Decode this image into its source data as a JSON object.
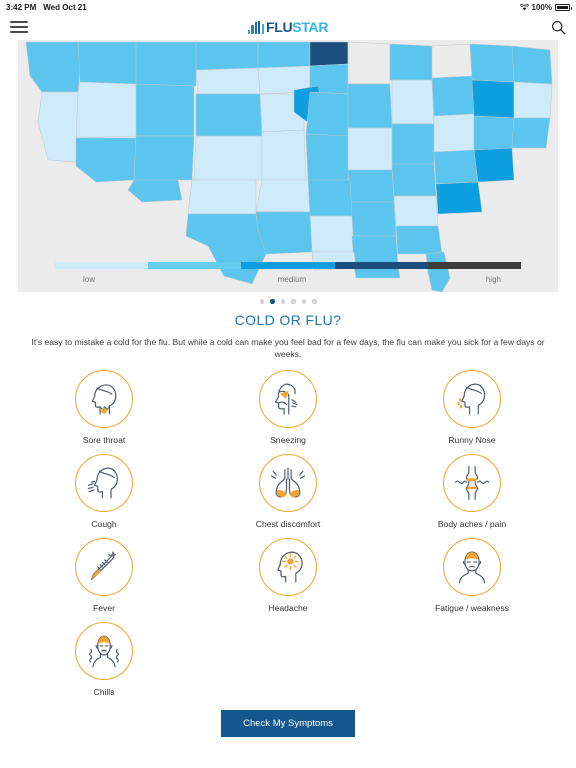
{
  "status_bar": {
    "time": "3:42 PM",
    "date": "Wed Oct 21",
    "battery_percent": "100%",
    "wifi_icon": "wifi-icon",
    "battery_icon": "battery-icon"
  },
  "nav": {
    "menu_icon": "hamburger-menu-icon",
    "search_icon": "search-icon",
    "logo_bars_icon": "bar-chart-logo-icon",
    "logo_primary": "FLU",
    "logo_secondary": "STAR"
  },
  "map": {
    "legend": {
      "colors": [
        "#cdeaf8",
        "#65cdf0",
        "#0c9ede",
        "#1b4e7e",
        "#3b3b3b"
      ],
      "labels": {
        "low": "low",
        "medium": "medium",
        "high": "high"
      }
    },
    "pager": {
      "count": 6,
      "active_index": 1
    }
  },
  "section": {
    "title": "COLD OR FLU?",
    "description": "It's easy to mistake a cold for the flu. But while a cold can make you feel bad for a few days, the flu can make you sick for a few days or weeks.",
    "title_color": "#2076b5",
    "accent_color": "#f2a32c"
  },
  "symptoms": [
    {
      "label": "Sore throat",
      "icon": "sore-throat-icon"
    },
    {
      "label": "Sneezing",
      "icon": "sneezing-icon"
    },
    {
      "label": "Runny Nose",
      "icon": "runny-nose-icon"
    },
    {
      "label": "Cough",
      "icon": "cough-icon"
    },
    {
      "label": "Chest discomfort",
      "icon": "chest-discomfort-icon"
    },
    {
      "label": "Body aches / pain",
      "icon": "body-aches-icon"
    },
    {
      "label": "Fever",
      "icon": "fever-thermometer-icon"
    },
    {
      "label": "Headache",
      "icon": "headache-icon"
    },
    {
      "label": "Fatigue / weakness",
      "icon": "fatigue-icon"
    },
    {
      "label": "Chills",
      "icon": "chills-icon"
    }
  ],
  "footer": {
    "cta_label": "Check My Symptoms",
    "cta_color": "#15578c"
  }
}
